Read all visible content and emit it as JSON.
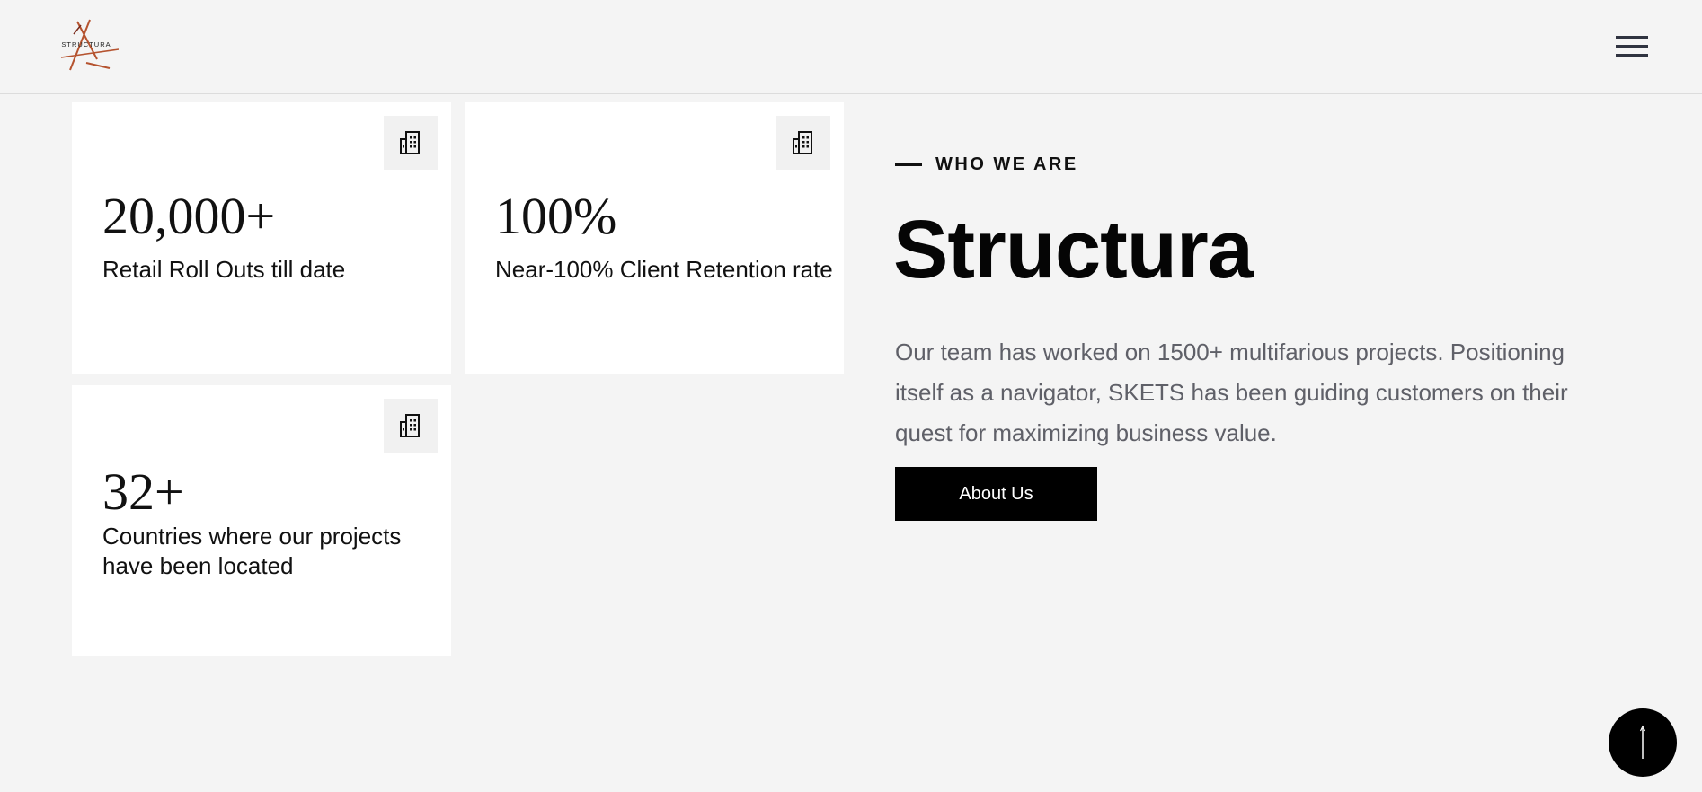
{
  "header": {
    "logo_text": "STRUCTURA",
    "menu_icon": "hamburger-menu-icon"
  },
  "stats": [
    {
      "value": "20,000+",
      "label": "Retail Roll Outs till date",
      "icon": "building-icon"
    },
    {
      "value": "100%",
      "label": "Near-100% Client Retention rate",
      "icon": "building-icon"
    },
    {
      "value": "32+",
      "label": "Countries where our projects have been located",
      "icon": "building-icon"
    }
  ],
  "about": {
    "eyebrow": "WHO WE ARE",
    "title": "Structura",
    "description": "Our team has worked on 1500+ multifarious projects. Positioning itself as a navigator, SKETS has been guiding customers on their quest for maximizing business value.",
    "button_label": "About Us"
  },
  "scroll_top_icon": "arrow-up-icon",
  "colors": {
    "background": "#f4f4f4",
    "card": "#ffffff",
    "accent": "#000000",
    "logo_stroke": "#b5532f"
  }
}
